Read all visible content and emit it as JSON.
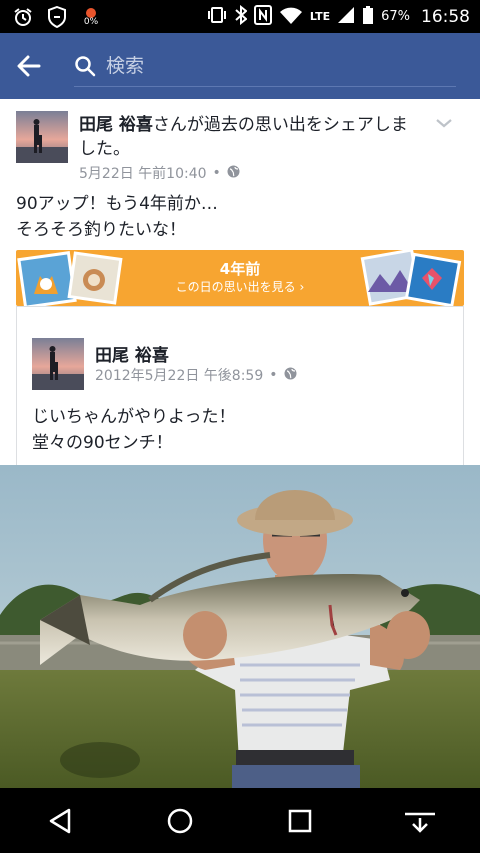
{
  "status_bar": {
    "battery_small": "0%",
    "network": "LTE",
    "battery_percent": "67%",
    "time": "16:58"
  },
  "search": {
    "placeholder": "検索"
  },
  "post": {
    "author": "田尾 裕喜",
    "action": "さんが過去の思い出をシェアしました。",
    "timestamp": "5月22日 午前10:40",
    "text_line1": "90アップ！もう4年前か…",
    "text_line2": "そろそろ釣りたいな！"
  },
  "memory_banner": {
    "title": "4年前",
    "subtitle": "この日の思い出を見る"
  },
  "shared_post": {
    "author": "田尾 裕喜",
    "timestamp": "2012年5月22日 午後8:59",
    "text_line1": "じいちゃんがやりよった！",
    "text_line2": "堂々の90センチ！"
  },
  "icons": {
    "globe": "globe-icon",
    "back": "back-arrow-icon",
    "search": "search-icon"
  },
  "colors": {
    "facebook_blue": "#3b5998",
    "banner_orange": "#f7a531",
    "meta_gray": "#90949c"
  }
}
